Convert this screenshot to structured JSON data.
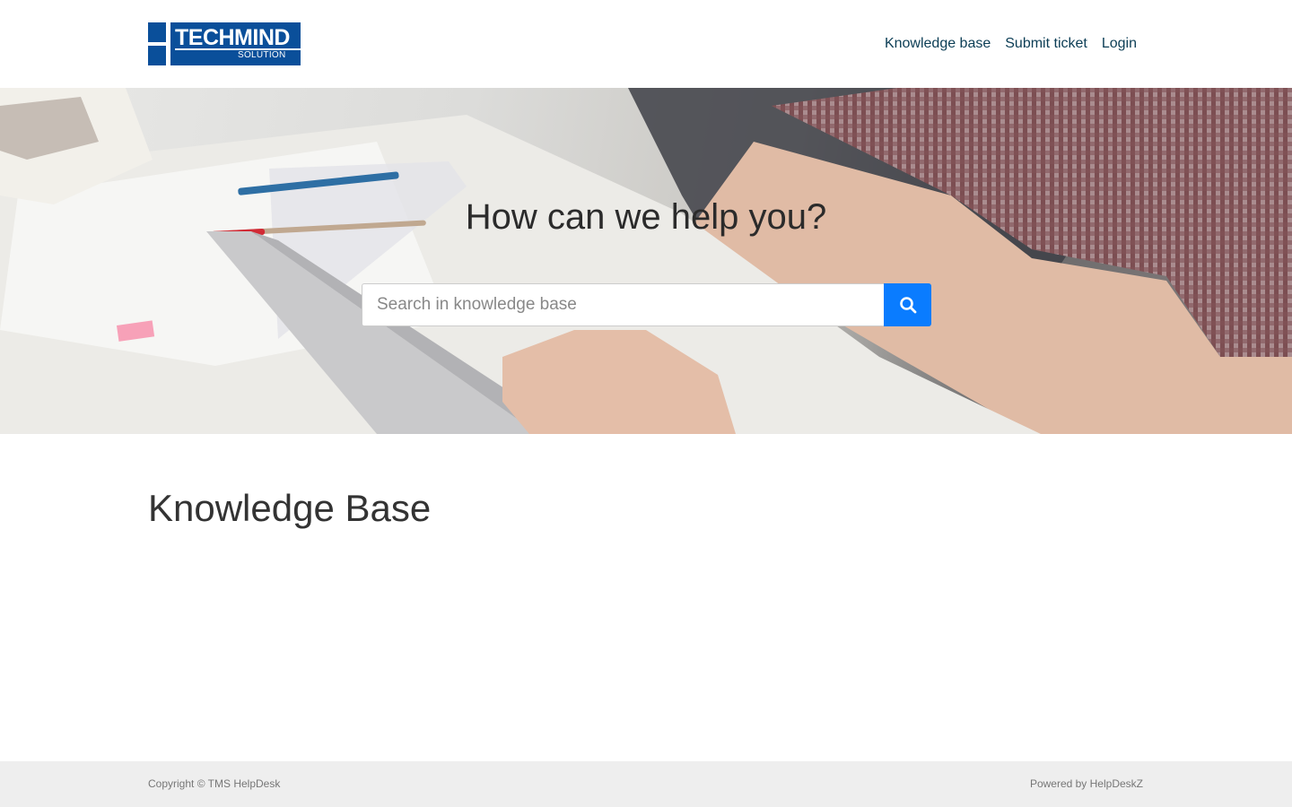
{
  "brand": {
    "logo_main": "TECHMIND",
    "logo_sub": "SOLUTION",
    "color": "#0a4f9a"
  },
  "nav": {
    "items": [
      {
        "label": "Knowledge base"
      },
      {
        "label": "Submit ticket"
      },
      {
        "label": "Login"
      }
    ],
    "link_color": "#0b3d55"
  },
  "hero": {
    "title": "How can we help you?",
    "search": {
      "placeholder": "Search in knowledge base",
      "value": "",
      "button_icon": "search-icon",
      "button_color": "#0a7cff"
    }
  },
  "main": {
    "heading": "Knowledge Base"
  },
  "footer": {
    "copyright": "Copyright © TMS HelpDesk",
    "powered_by": "Powered by HelpDeskZ"
  }
}
